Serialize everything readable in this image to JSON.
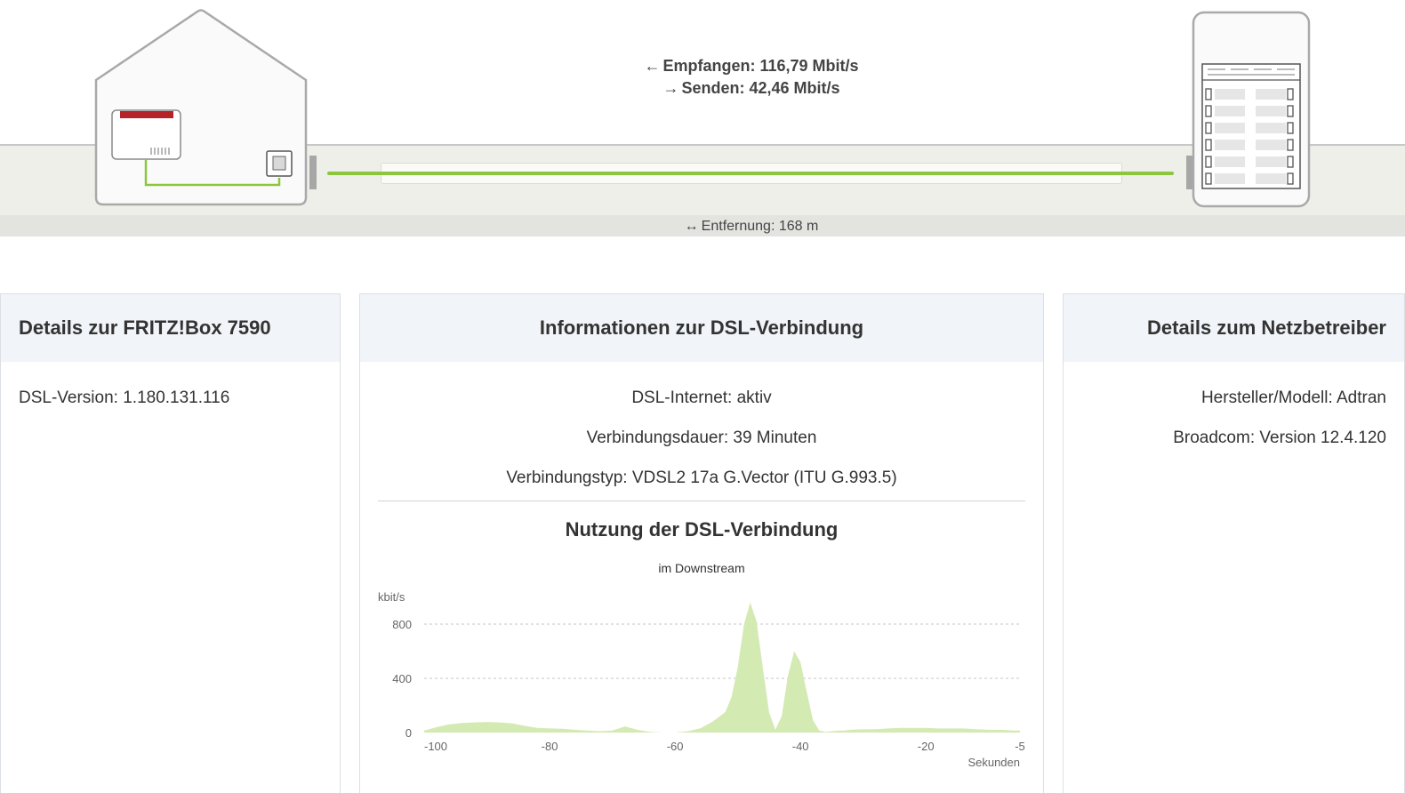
{
  "diagram": {
    "receive_label": "Empfangen: 116,79 Mbit/s",
    "send_label": "Senden: 42,46 Mbit/s",
    "distance_label": "Entfernung: 168 m"
  },
  "fritzbox_panel": {
    "title": "Details zur FRITZ!Box 7590",
    "dsl_version": "DSL-Version: 1.180.131.116"
  },
  "dsl_panel": {
    "title": "Informationen zur DSL-Verbindung",
    "status": "DSL-Internet: aktiv",
    "duration": "Verbindungsdauer: 39 Minuten",
    "type": "Verbindungstyp: VDSL2 17a G.Vector (ITU G.993.5)",
    "usage_title": "Nutzung der DSL-Verbindung",
    "usage_subtitle": "im Downstream"
  },
  "operator_panel": {
    "title": "Details zum Netzbetreiber",
    "manufacturer": "Hersteller/Modell: Adtran",
    "broadcom": "Broadcom: Version 12.4.120"
  },
  "colors": {
    "cable": "#8cc63f",
    "chart_fill": "#d4eab3",
    "header_bg": "#f1f4f8",
    "fritz_red": "#b52228"
  },
  "chart_data": {
    "type": "area",
    "ylabel": "kbit/s",
    "xlabel": "Sekunden",
    "ylim": [
      0,
      800
    ],
    "xlim": [
      -100,
      -5
    ],
    "y_ticks": [
      "800",
      "400",
      "0"
    ],
    "y_tick_values": [
      800,
      400,
      0
    ],
    "x_ticks": [
      "-100",
      "-80",
      "-60",
      "-40",
      "-20",
      "-5"
    ],
    "x_tick_values": [
      -100,
      -80,
      -60,
      -40,
      -20,
      -5
    ],
    "grid": true,
    "x": [
      -100,
      -98,
      -96,
      -94,
      -92,
      -90,
      -88,
      -86,
      -84,
      -82,
      -80,
      -78,
      -76,
      -74,
      -72,
      -70,
      -68,
      -66,
      -64,
      -62,
      -60,
      -58,
      -56,
      -54,
      -52,
      -51,
      -50,
      -49,
      -48,
      -47,
      -46,
      -45,
      -44,
      -43,
      -42,
      -41,
      -40,
      -39,
      -38,
      -37,
      -36,
      -35,
      -34,
      -33,
      -32,
      -30,
      -28,
      -26,
      -24,
      -22,
      -20,
      -18,
      -16,
      -14,
      -12,
      -10,
      -8,
      -6,
      -5
    ],
    "values": [
      15,
      40,
      60,
      70,
      75,
      78,
      75,
      68,
      50,
      35,
      30,
      28,
      20,
      15,
      10,
      15,
      45,
      20,
      5,
      0,
      0,
      10,
      30,
      80,
      150,
      260,
      480,
      800,
      960,
      820,
      480,
      150,
      20,
      120,
      420,
      600,
      520,
      300,
      90,
      15,
      5,
      10,
      15,
      15,
      20,
      25,
      25,
      30,
      35,
      35,
      35,
      30,
      30,
      30,
      25,
      20,
      20,
      15,
      15
    ]
  }
}
